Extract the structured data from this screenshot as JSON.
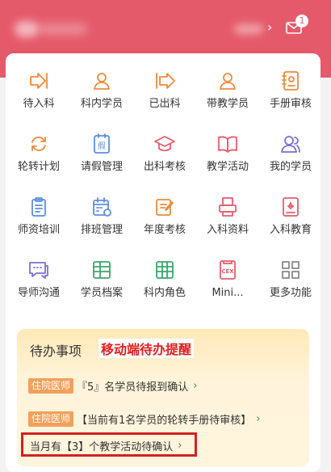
{
  "header": {
    "chevron": "›",
    "notification_count": "1"
  },
  "grid": {
    "items": [
      {
        "label": "待入科",
        "icon": "enter-arrow-icon",
        "color": "#f08a3c"
      },
      {
        "label": "科内学员",
        "icon": "user-icon",
        "color": "#f08a3c"
      },
      {
        "label": "已出科",
        "icon": "exit-arrow-icon",
        "color": "#f08a3c"
      },
      {
        "label": "带教学员",
        "icon": "user-icon",
        "color": "#f08a3c"
      },
      {
        "label": "手册审核",
        "icon": "handbook-icon",
        "color": "#f08a3c"
      },
      {
        "label": "轮转计划",
        "icon": "rotate-icon",
        "color": "#f08a3c"
      },
      {
        "label": "请假管理",
        "icon": "leave-icon",
        "color": "#5b8fe0"
      },
      {
        "label": "出科考核",
        "icon": "graduation-cap-icon",
        "color": "#e85c6b"
      },
      {
        "label": "教学活动",
        "icon": "book-icon",
        "color": "#e85c6b"
      },
      {
        "label": "我的学员",
        "icon": "users-icon",
        "color": "#7a6fd8"
      },
      {
        "label": "师资培训",
        "icon": "clipboard-icon",
        "color": "#5b8fe0"
      },
      {
        "label": "排班管理",
        "icon": "calendar-icon",
        "color": "#5b8fe0"
      },
      {
        "label": "年度考核",
        "icon": "edit-icon",
        "color": "#f08a3c"
      },
      {
        "label": "入科资料",
        "icon": "printer-icon",
        "color": "#e85c6b"
      },
      {
        "label": "入科教育",
        "icon": "badge-book-icon",
        "color": "#e85c6b"
      },
      {
        "label": "导师沟通",
        "icon": "chat-icon",
        "color": "#7a6fd8"
      },
      {
        "label": "学员档案",
        "icon": "archive-icon",
        "color": "#3aa66a"
      },
      {
        "label": "科内角色",
        "icon": "columns-icon",
        "color": "#3aa66a"
      },
      {
        "label": "Mini...",
        "icon": "cex-icon",
        "color": "#e85c6b",
        "icon_text": "CEX"
      },
      {
        "label": "更多功能",
        "icon": "grid-icon",
        "color": "#888888"
      }
    ]
  },
  "todo": {
    "title": "待办事项",
    "highlight": "移动端待办提醒",
    "rows": [
      {
        "tag": "住院医师",
        "text": "『5』名学员待报到确认",
        "arrow": "›"
      },
      {
        "tag": "住院医师",
        "text": "【当前有1名学员的轮转手册待审核】",
        "arrow": "›"
      },
      {
        "text": "当月有【3】个教学活动待确认",
        "arrow": "›"
      }
    ]
  }
}
